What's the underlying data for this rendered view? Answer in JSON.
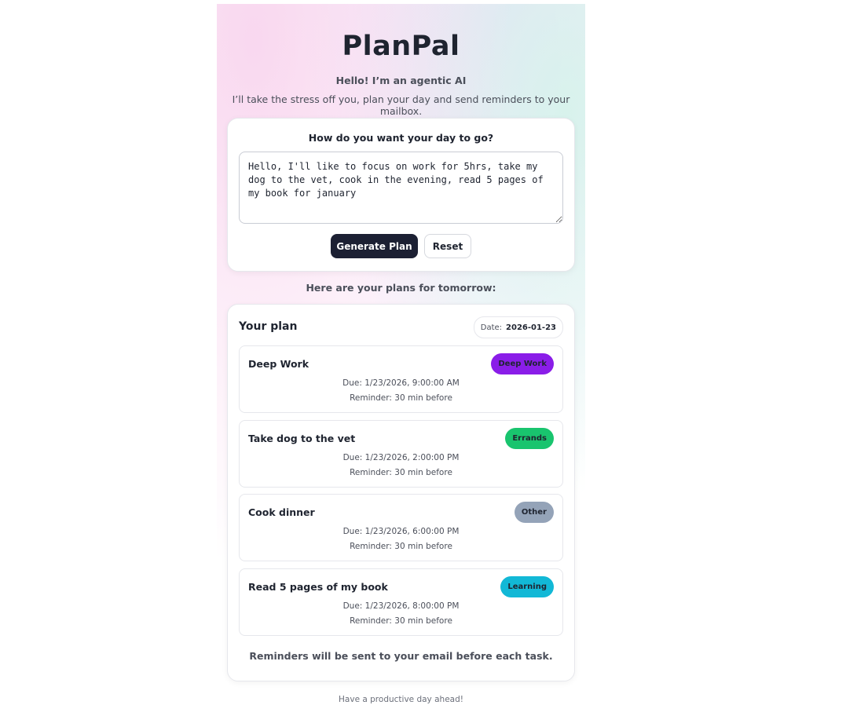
{
  "header": {
    "title": "PlanPal",
    "subtitle": "Hello! I’m an agentic AI",
    "tagline": "I’ll take the stress off you, plan your day and send reminders to your mailbox."
  },
  "input_card": {
    "question": "How do you want your day to go?",
    "textarea_value": "Hello, I'll like to focus on work for 5hrs, take my dog to the vet, cook in the evening, read 5 pages of my book for january",
    "generate_label": "Generate Plan",
    "reset_label": "Reset"
  },
  "plans_heading": "Here are your plans for tomorrow:",
  "plan": {
    "title": "Your plan",
    "date_label": "Date:",
    "date_value": "2026-01-23",
    "tasks": [
      {
        "name": "Deep Work",
        "tag": "Deep Work",
        "tag_color": "#8a1de8",
        "due": "Due: 1/23/2026, 9:00:00 AM",
        "reminder": "Reminder: 30 min before"
      },
      {
        "name": "Take dog to the vet",
        "tag": "Errands",
        "tag_color": "#19c46e",
        "due": "Due: 1/23/2026, 2:00:00 PM",
        "reminder": "Reminder: 30 min before"
      },
      {
        "name": "Cook dinner",
        "tag": "Other",
        "tag_color": "#94a3b8",
        "due": "Due: 1/23/2026, 6:00:00 PM",
        "reminder": "Reminder: 30 min before"
      },
      {
        "name": "Read 5 pages of my book",
        "tag": "Learning",
        "tag_color": "#12b8d6",
        "due": "Due: 1/23/2026, 8:00:00 PM",
        "reminder": "Reminder: 30 min before"
      }
    ],
    "reminder_note": "Reminders will be sent to your email before each task."
  },
  "footer": "Have a productive day ahead!"
}
